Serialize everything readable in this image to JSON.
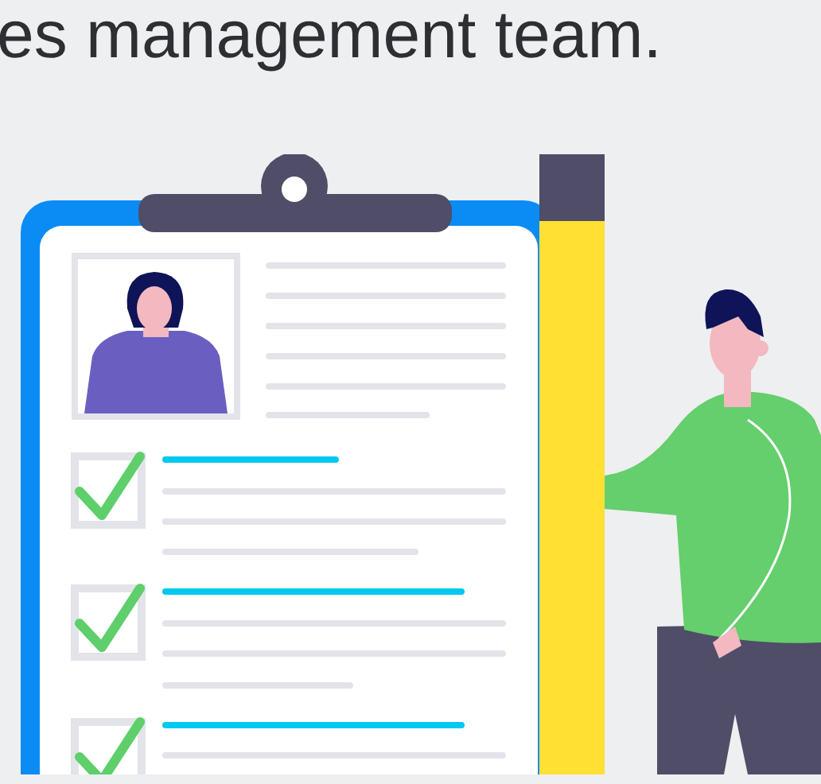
{
  "heading": {
    "text": "es management team."
  }
}
